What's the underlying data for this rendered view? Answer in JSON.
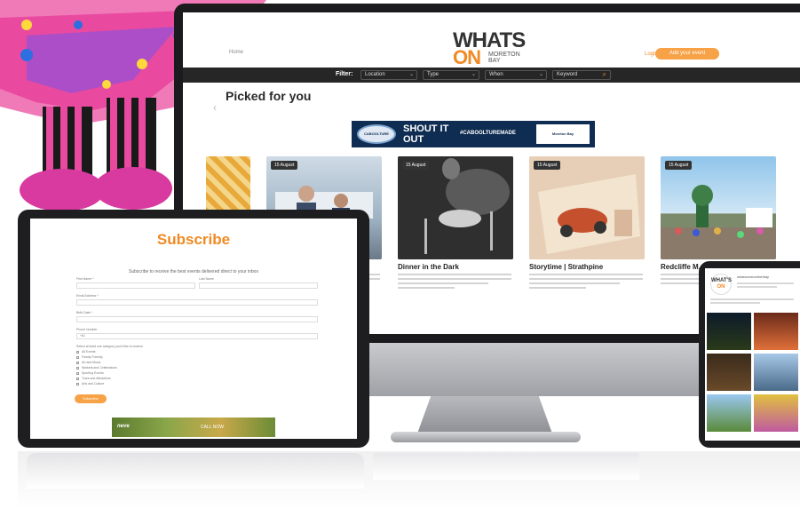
{
  "colors": {
    "accent": "#f08a24",
    "dark_bar": "#262626",
    "banner": "#0f2d52"
  },
  "site": {
    "logo_top": "WHATS",
    "logo_bottom": "ON",
    "logo_sub": "MORETON BAY",
    "nav_link": "Home",
    "login": "Login",
    "add_event": "Add your event"
  },
  "filters": {
    "label": "Filter:",
    "location": "Location",
    "type": "Type",
    "when": "When",
    "keyword": "Keyword"
  },
  "picked": {
    "title": "Picked for you"
  },
  "banner": {
    "badge": "CABOOLTURE",
    "headline": "SHOUT IT OUT",
    "hashtag": "#CABOOLTUREMADE",
    "partner": "Moreton Bay"
  },
  "cards": [
    {
      "date": "",
      "title": ""
    },
    {
      "date": "15 August",
      "title": ""
    },
    {
      "date": "15 August",
      "title": "Dinner in the Dark"
    },
    {
      "date": "15 August",
      "title": "Storytime | Strathpine"
    },
    {
      "date": "15 August",
      "title": "Redcliffe M..."
    }
  ],
  "subscribe": {
    "title": "Subscribe",
    "description": "Subscribe to receive the best events delivered direct to your inbox",
    "first_name": "First Name *",
    "last_name": "Last Name",
    "email": "Email Address *",
    "dob": "Birth Date *",
    "phone": "Phone Number",
    "phone_prefix": "+61",
    "interest_prompt": "Select at least one category you'd like to receive",
    "interests": [
      "All Events",
      "Family Friendly",
      "Art and Music",
      "Markets and Celebrations",
      "Sporting Events",
      "Tours and Attractions",
      "Arts and Culture"
    ],
    "button": "Subscribe"
  },
  "ad": {
    "logo": "neve",
    "text": "CALL NOW"
  },
  "phone": {
    "logo_top": "WHAT'S",
    "logo_bottom": "ON",
    "profile_name": "whatsonmoretonbay"
  }
}
